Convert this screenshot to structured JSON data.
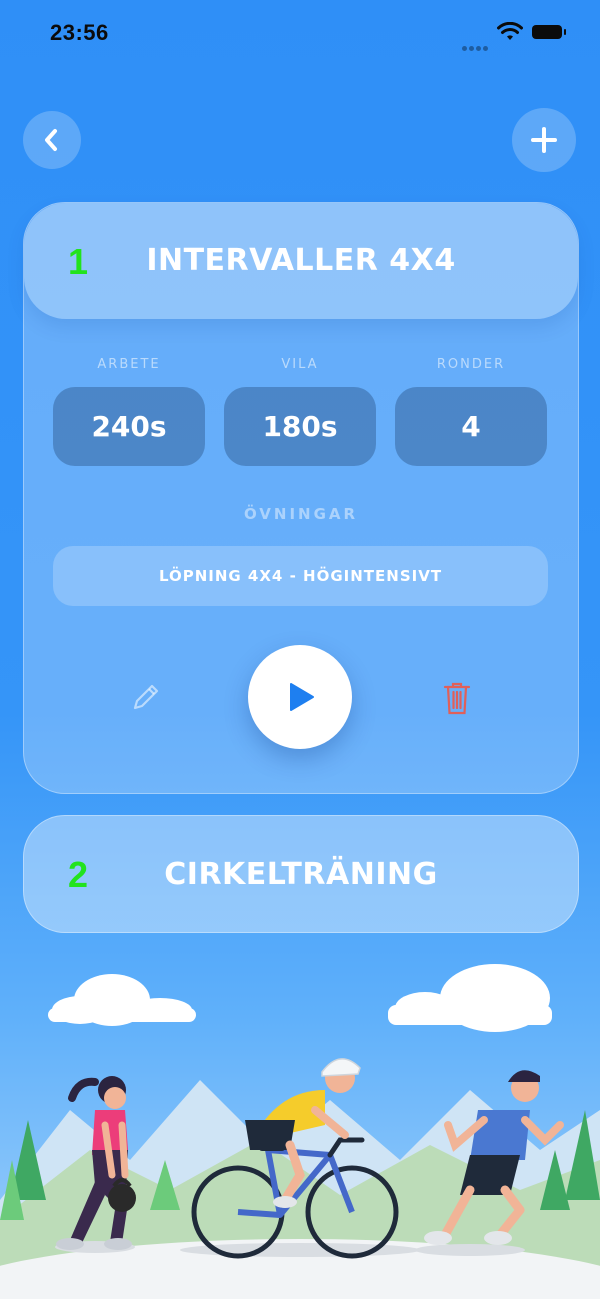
{
  "status_bar": {
    "time": "23:56"
  },
  "nav": {
    "back_icon": "chevron-left-icon",
    "add_icon": "plus-icon"
  },
  "workouts": [
    {
      "number": "1",
      "title": "INTERVALLER 4X4",
      "expanded": true,
      "stats": [
        {
          "label": "ARBETE",
          "value": "240s"
        },
        {
          "label": "VILA",
          "value": "180s"
        },
        {
          "label": "RONDER",
          "value": "4"
        }
      ],
      "exercises_label": "ÖVNINGAR",
      "exercises": [
        "LÖPNING 4X4 - HÖGINTENSIVT"
      ],
      "actions": {
        "edit_icon": "pencil-icon",
        "play_icon": "play-icon",
        "delete_icon": "trash-icon"
      }
    },
    {
      "number": "2",
      "title": "CIRKELTRÄNING",
      "expanded": false
    }
  ],
  "colors": {
    "accent": "#2f8ff7",
    "number_green": "#22e31d",
    "delete_red": "#e0605a"
  },
  "illustration": "people-exercising-illustration"
}
